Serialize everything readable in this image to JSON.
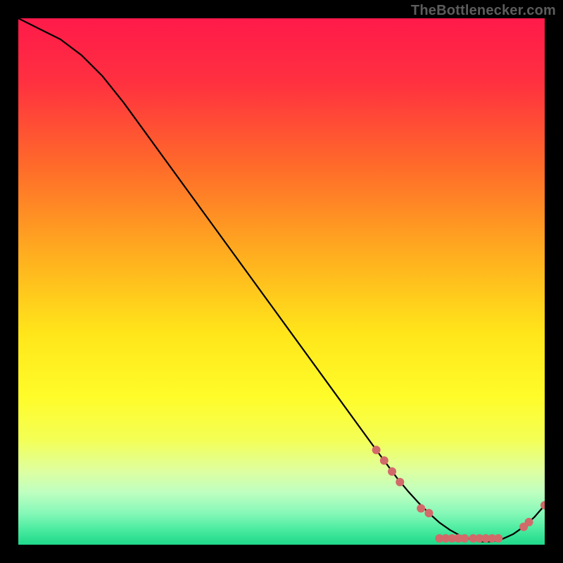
{
  "watermark": "TheBottlenecker.com",
  "chart_data": {
    "type": "line",
    "title": "",
    "xlabel": "",
    "ylabel": "",
    "xlim": [
      0,
      100
    ],
    "ylim": [
      0,
      100
    ],
    "grid": false,
    "background": "rainbow-vertical-gradient red→yellow→green",
    "series": [
      {
        "name": "curve",
        "color": "#000000",
        "x": [
          0,
          4,
          8,
          12,
          16,
          20,
          24,
          28,
          32,
          36,
          40,
          44,
          48,
          52,
          56,
          60,
          64,
          68,
          70,
          72,
          74,
          76,
          78,
          80,
          82,
          84,
          86,
          88,
          90,
          92,
          94,
          96,
          98,
          100
        ],
        "values": [
          100,
          98,
          96,
          93,
          89,
          84,
          78.5,
          73,
          67.5,
          62,
          56.5,
          51,
          45.5,
          40,
          34.5,
          29,
          23.5,
          18,
          15.3,
          12.6,
          10.2,
          8.0,
          6.0,
          4.2,
          2.8,
          1.7,
          1.0,
          0.6,
          0.6,
          1.1,
          2.0,
          3.4,
          5.2,
          7.5
        ]
      }
    ],
    "markers": [
      {
        "x": 68.0,
        "y": 18.0
      },
      {
        "x": 69.5,
        "y": 16.0
      },
      {
        "x": 71.0,
        "y": 13.9
      },
      {
        "x": 72.5,
        "y": 11.9
      },
      {
        "x": 76.5,
        "y": 6.9
      },
      {
        "x": 78.0,
        "y": 6.0
      },
      {
        "x": 80.0,
        "y": 1.2
      },
      {
        "x": 81.2,
        "y": 1.2
      },
      {
        "x": 82.4,
        "y": 1.2
      },
      {
        "x": 83.6,
        "y": 1.2
      },
      {
        "x": 84.8,
        "y": 1.2
      },
      {
        "x": 86.4,
        "y": 1.2
      },
      {
        "x": 87.6,
        "y": 1.2
      },
      {
        "x": 88.8,
        "y": 1.2
      },
      {
        "x": 90.0,
        "y": 1.2
      },
      {
        "x": 91.2,
        "y": 1.2
      },
      {
        "x": 96.0,
        "y": 3.4
      },
      {
        "x": 97.0,
        "y": 4.3
      },
      {
        "x": 100.0,
        "y": 7.5
      }
    ],
    "marker_style": {
      "color": "#d26a6a",
      "radius_px": 6
    },
    "gradient_stops": [
      {
        "offset": 0.0,
        "color": "#ff1a4a"
      },
      {
        "offset": 0.12,
        "color": "#ff3040"
      },
      {
        "offset": 0.28,
        "color": "#ff6a2a"
      },
      {
        "offset": 0.45,
        "color": "#ffae1f"
      },
      {
        "offset": 0.6,
        "color": "#ffe61a"
      },
      {
        "offset": 0.72,
        "color": "#fffc2a"
      },
      {
        "offset": 0.8,
        "color": "#f4ff55"
      },
      {
        "offset": 0.86,
        "color": "#deffa0"
      },
      {
        "offset": 0.9,
        "color": "#bfffc0"
      },
      {
        "offset": 0.94,
        "color": "#86f8b8"
      },
      {
        "offset": 0.97,
        "color": "#4ceca0"
      },
      {
        "offset": 1.0,
        "color": "#1fd88a"
      }
    ]
  }
}
